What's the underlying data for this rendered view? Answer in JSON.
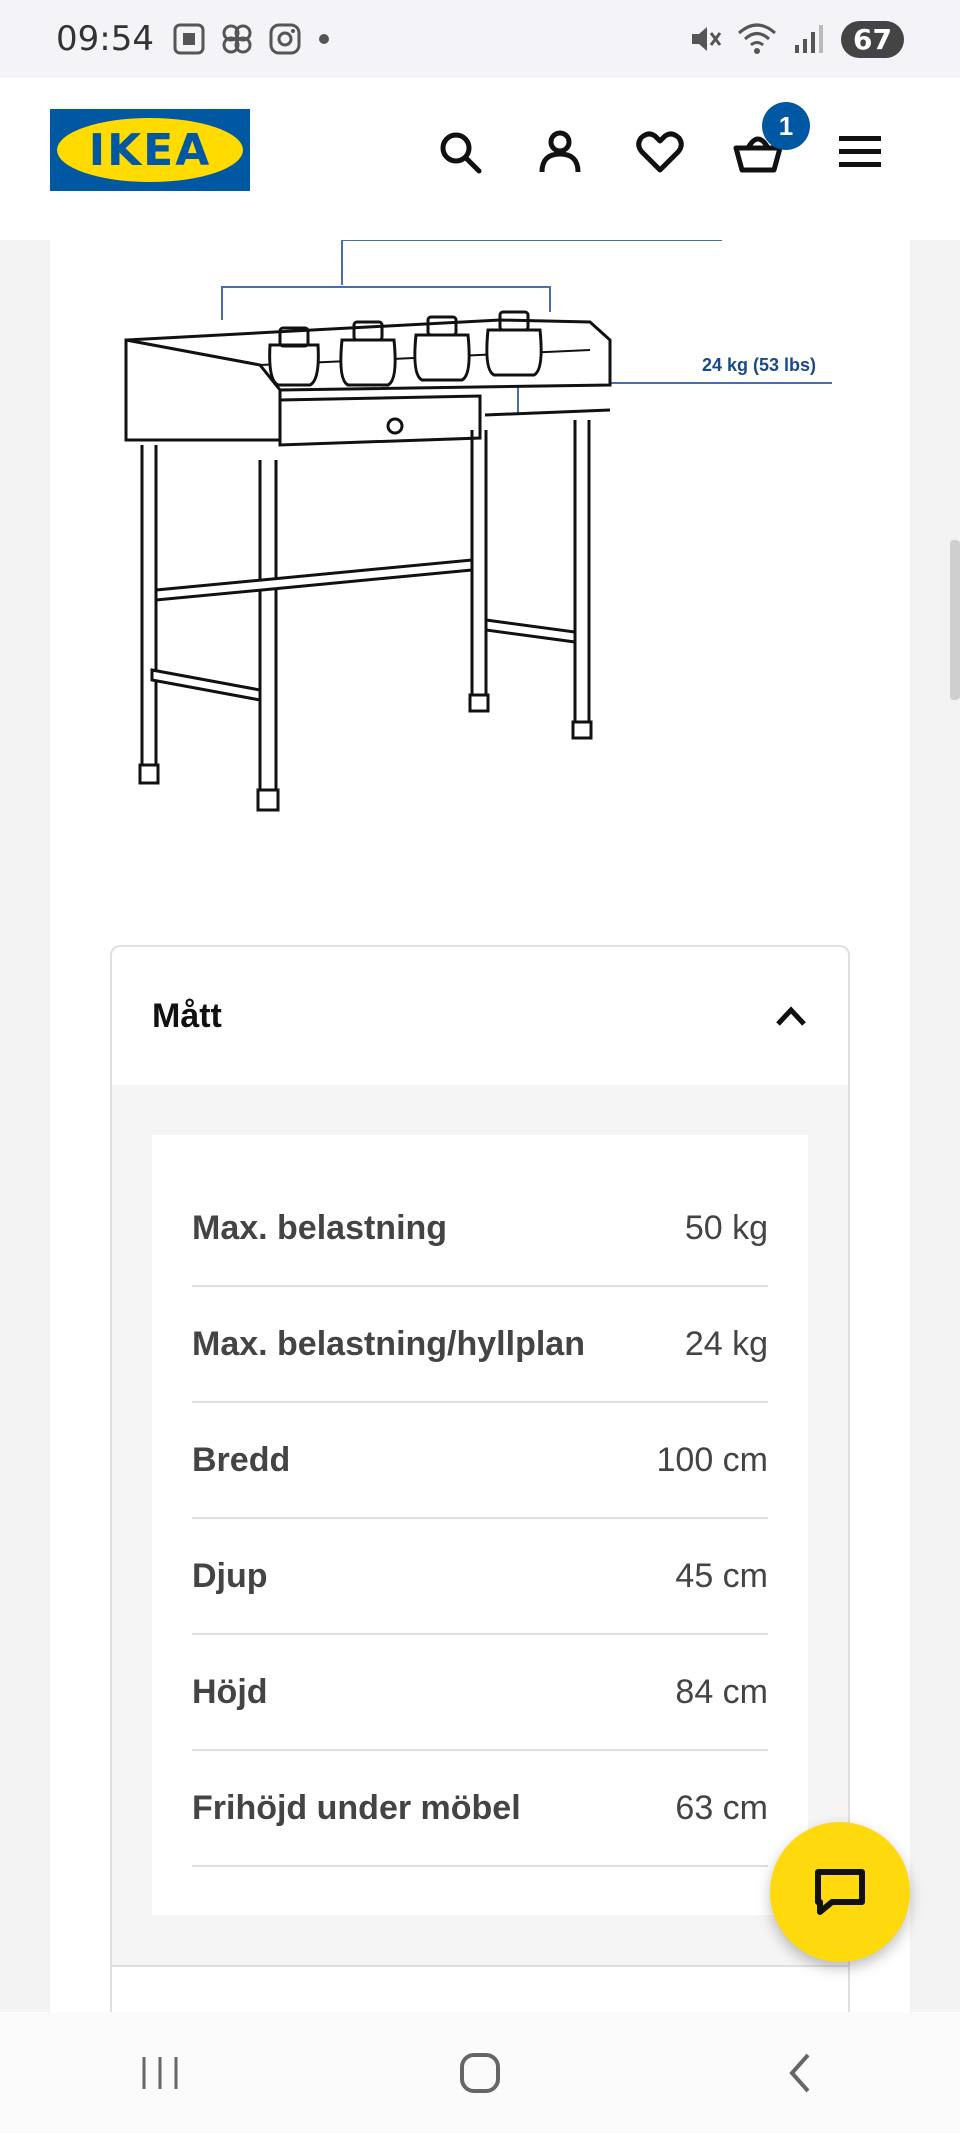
{
  "status_bar": {
    "time": "09:54",
    "battery": "67",
    "left_icons": [
      "screenshot-icon",
      "pinwheel-icon",
      "instagram-icon",
      "dot-icon"
    ],
    "right_icons": [
      "mute-icon",
      "wifi-icon",
      "signal-icon"
    ]
  },
  "header": {
    "logo_text": "IKEA",
    "cart_count": "1",
    "icons": [
      "search-icon",
      "account-icon",
      "heart-icon",
      "basket-icon",
      "menu-icon"
    ]
  },
  "product_image": {
    "load_label": "24 kg (53 lbs)"
  },
  "dimensions": {
    "title": "Mått",
    "rows": [
      {
        "label": "Max. belastning",
        "value": "50 kg"
      },
      {
        "label": "Max. belastning/hyllplan",
        "value": "24 kg"
      },
      {
        "label": "Bredd",
        "value": "100 cm"
      },
      {
        "label": "Djup",
        "value": "45 cm"
      },
      {
        "label": "Höjd",
        "value": "84 cm"
      },
      {
        "label": "Frihöjd under möbel",
        "value": "63 cm"
      }
    ]
  },
  "colors": {
    "ikea_blue": "#0058a3",
    "ikea_yellow": "#ffdb00",
    "chat_yellow": "#fdd90e"
  }
}
